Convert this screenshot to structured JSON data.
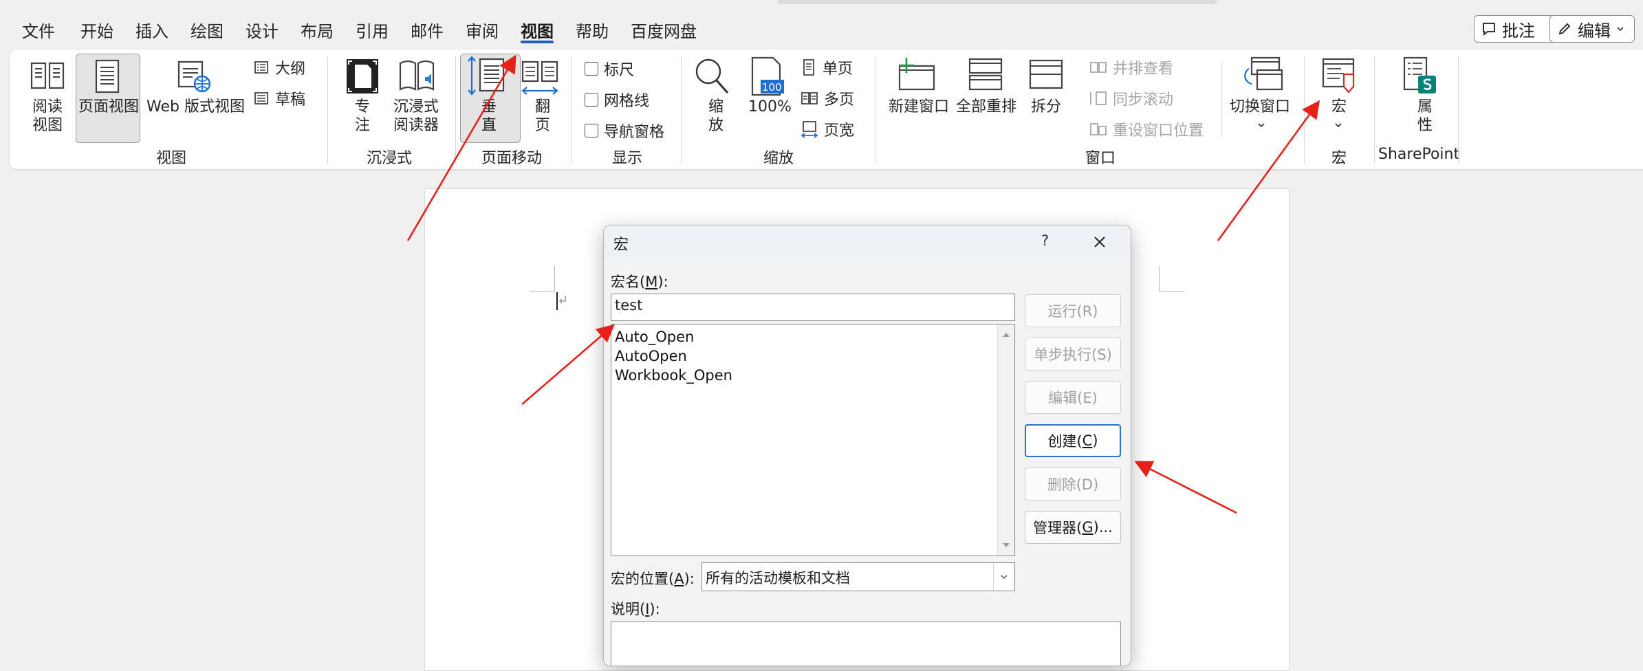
{
  "menu": {
    "items": [
      "文件",
      "开始",
      "插入",
      "绘图",
      "设计",
      "布局",
      "引用",
      "邮件",
      "审阅",
      "视图",
      "帮助",
      "百度网盘"
    ],
    "active": "视图",
    "comment_button": "批注",
    "edit_button": "编辑"
  },
  "ribbon": {
    "view_group": {
      "label": "视图",
      "read_mode_line1": "阅读",
      "read_mode_line2": "视图",
      "print_layout": "页面视图",
      "web_layout": "Web 版式视图",
      "outline": "大纲",
      "draft": "草稿"
    },
    "immersive_group": {
      "label": "沉浸式",
      "focus_line1": "专",
      "focus_line2": "注",
      "reader_line1": "沉浸式",
      "reader_line2": "阅读器"
    },
    "page_move_group": {
      "label": "页面移动",
      "vertical_line1": "垂",
      "vertical_line2": "直",
      "side_line1": "翻",
      "side_line2": "页"
    },
    "show_group": {
      "label": "显示",
      "ruler": "标尺",
      "gridlines": "网格线",
      "nav_pane": "导航窗格"
    },
    "zoom_group": {
      "label": "缩放",
      "zoom_line1": "缩",
      "zoom_line2": "放",
      "hundred_badge": "100",
      "hundred": "100%",
      "one_page": "单页",
      "multi_page": "多页",
      "page_width": "页宽"
    },
    "window_group": {
      "label": "窗口",
      "new_window": "新建窗口",
      "arrange_all": "全部重排",
      "split": "拆分",
      "side_by_side": "并排查看",
      "sync_scroll": "同步滚动",
      "reset_position": "重设窗口位置",
      "switch_windows": "切换窗口"
    },
    "macro_group": {
      "label": "宏",
      "macros": "宏"
    },
    "sharepoint_group": {
      "label": "SharePoint",
      "properties_line1": "属",
      "properties_line2": "性"
    }
  },
  "dialog": {
    "title": "宏",
    "help": "?",
    "macro_name_label_pre": "宏名(",
    "macro_name_label_key": "M",
    "macro_name_label_post": "):",
    "macro_name_value": "test",
    "macro_list": [
      "Auto_Open",
      "AutoOpen",
      "Workbook_Open"
    ],
    "macros_in_label_pre": "宏的位置(",
    "macros_in_label_key": "A",
    "macros_in_label_post": "):",
    "macros_in_value": "所有的活动模板和文档",
    "description_label_pre": "说明(",
    "description_label_key": "I",
    "description_label_post": "):",
    "buttons": {
      "run": "运行(R)",
      "step_into": "单步执行(S)",
      "edit": "编辑(E)",
      "create_pre": "创建(",
      "create_key": "C",
      "create_post": ")",
      "delete": "删除(D)",
      "organizer_pre": "管理器(",
      "organizer_key": "G",
      "organizer_post": ")..."
    }
  },
  "colors": {
    "accent": "#1f5fbf",
    "annotation_arrow": "#e8201a",
    "focus_border": "#2d74c9"
  }
}
